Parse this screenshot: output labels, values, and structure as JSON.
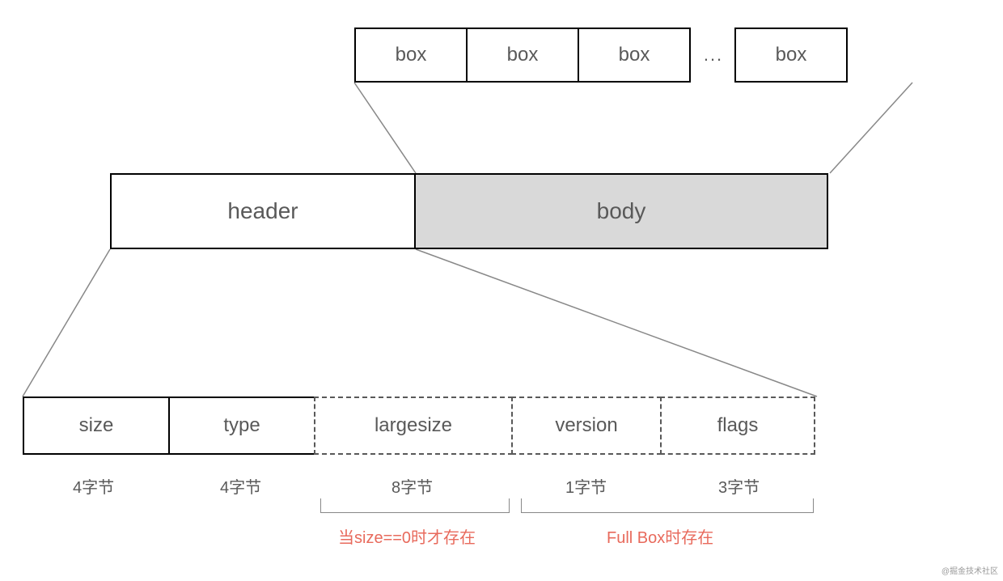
{
  "top_boxes": {
    "label": "box",
    "ellipsis": "..."
  },
  "middle": {
    "header": "header",
    "body": "body"
  },
  "header_fields": {
    "size": {
      "label": "size",
      "bytes": "4字节"
    },
    "type": {
      "label": "type",
      "bytes": "4字节"
    },
    "largesize": {
      "label": "largesize",
      "bytes": "8字节"
    },
    "version": {
      "label": "version",
      "bytes": "1字节"
    },
    "flags": {
      "label": "flags",
      "bytes": "3字节"
    }
  },
  "notes": {
    "largesize_condition": "当size==0时才存在",
    "fullbox_condition": "Full Box时存在"
  },
  "watermark": "@掘金技术社区"
}
